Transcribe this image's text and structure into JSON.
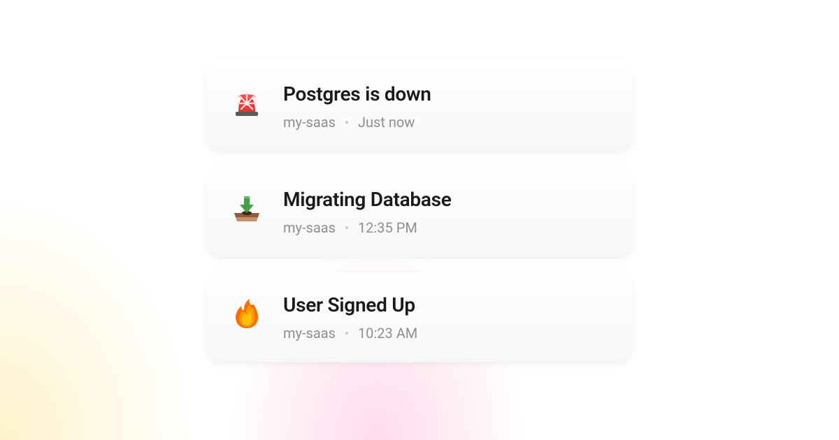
{
  "notifications": [
    {
      "icon": "siren",
      "title": "Postgres is down",
      "project": "my-saas",
      "time": "Just now"
    },
    {
      "icon": "download-tray",
      "title": "Migrating Database",
      "project": "my-saas",
      "time": "12:35 PM"
    },
    {
      "icon": "fire",
      "title": "User Signed Up",
      "project": "my-saas",
      "time": "10:23 AM"
    }
  ]
}
